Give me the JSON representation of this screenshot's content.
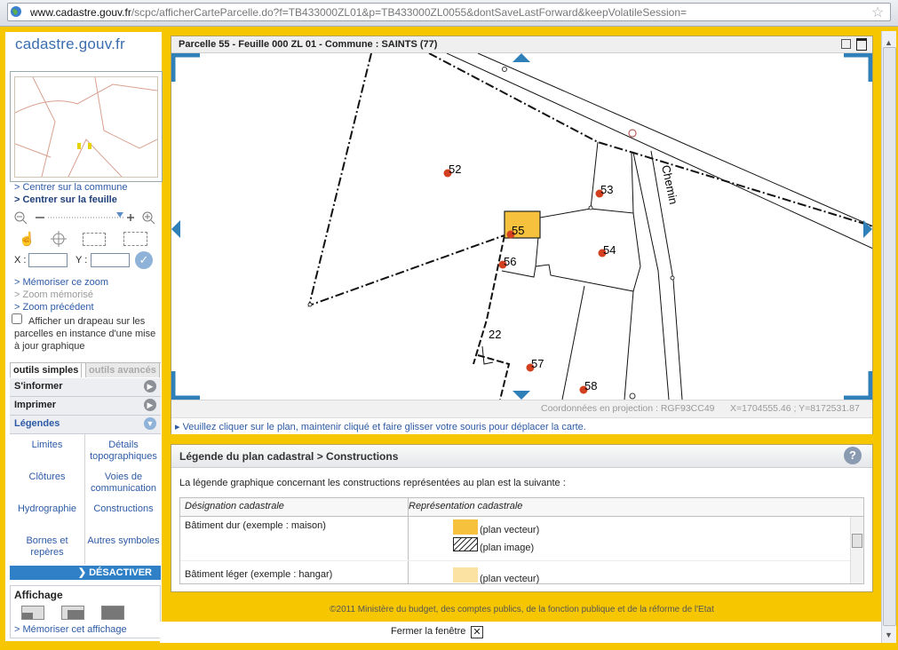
{
  "browser": {
    "url_domain": "www.cadastre.gouv.fr",
    "url_rest": "/scpc/afficherCarteParcelle.do?f=TB433000ZL01&p=TB433000ZL0055&dontSaveLastForward&keepVolatileSession="
  },
  "logo": "cadastre.gouv.fr",
  "nav": {
    "center_commune": "> Centrer sur la commune",
    "center_feuille": "> Centrer sur la feuille",
    "x_label": "X :",
    "y_label": "Y :",
    "memorize_zoom": "> Mémoriser ce zoom",
    "memorized_zoom": "> Zoom mémorisé",
    "previous_zoom": "> Zoom précédent",
    "flag_checkbox": "Afficher un drapeau sur les parcelles en instance d'une mise à jour graphique"
  },
  "tabs": {
    "simple": "outils simples",
    "advanced": "outils avancés"
  },
  "menu": {
    "inform": "S'informer",
    "print": "Imprimer",
    "legends": "Légendes"
  },
  "legend_grid": [
    "Limites",
    "Détails topographiques",
    "Clôtures",
    "Voies de communication",
    "Hydrographie",
    "Constructions",
    "Bornes et repères",
    "Autres symboles"
  ],
  "deactivate": "DÉSACTIVER",
  "affichage": {
    "title": "Affichage",
    "memorize": "> Mémoriser cet affichage"
  },
  "map": {
    "title": "Parcelle 55 - Feuille 000 ZL 01 - Commune : SAINTS (77)",
    "parcels": [
      "52",
      "53",
      "55",
      "54",
      "56",
      "22",
      "57",
      "58"
    ],
    "road_label": "Chemin",
    "coords_label": "Coordonnées en projection : RGF93CC49",
    "coords_value": "X=1704555.46 ; Y=8172531.87",
    "hint": "▸ Veuillez cliquer sur le plan, maintenir cliqué et faire glisser votre souris pour déplacer la carte.",
    "highlight_color": "#f6c23e"
  },
  "legend": {
    "title": "Légende du plan cadastral > Constructions",
    "intro": "La légende graphique concernant les constructions représentées au plan est la suivante :",
    "col_designation": "Désignation cadastrale",
    "col_representation": "Représentation cadastrale",
    "rows": [
      {
        "designation": "Bâtiment dur (exemple : maison)",
        "vector": "(plan vecteur)",
        "image": "(plan image)"
      },
      {
        "designation": "Bâtiment léger (exemple : hangar)",
        "vector": "(plan vecteur)"
      }
    ]
  },
  "footer": "©2011 Ministère du budget, des comptes publics, de la fonction publique et de la réforme de l'Etat",
  "close": "Fermer la fenêtre"
}
